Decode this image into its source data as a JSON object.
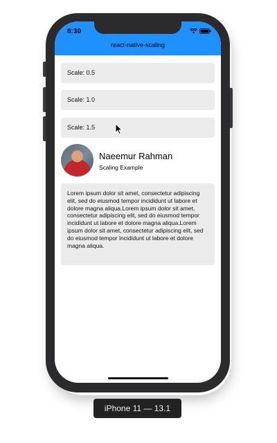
{
  "status_bar": {
    "time": "8:30",
    "wifi_icon": "wifi-icon",
    "battery_icon": "battery-icon"
  },
  "header": {
    "title": "react-native-scaling",
    "color": "#1e90ff"
  },
  "scale_options": [
    {
      "label": "Scale: 0.5"
    },
    {
      "label": "Scale: 1.0"
    },
    {
      "label": "Scale: 1.5"
    }
  ],
  "profile": {
    "name": "Naeemur Rahman",
    "subtitle": "Scaling Example"
  },
  "content": {
    "lorem": "Lorem ipsum dolor sit amet, consectetur adipiscing elit, sed do eiusmod tempor incididunt ut labore et dolore magna aliqua.Lorem ipsum dolor sit amet, consectetur adipiscing elit, sed do eiusmod tempor incididunt ut labore et dolore magna aliqua.Lorem ipsum dolor sit amet, consectetur adipiscing elit, sed do eiusmod tempor incididunt ut labore et dolore magna aliqua."
  },
  "device": {
    "label": "iPhone 11 — 13.1"
  },
  "icons": {
    "cursor": "cursor-icon"
  }
}
